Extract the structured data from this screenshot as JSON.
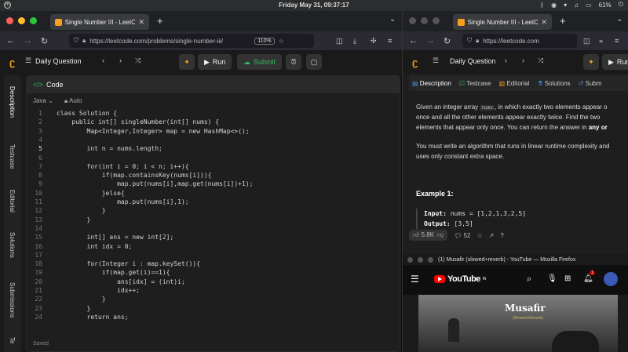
{
  "system": {
    "clock": "Friday May 31, 09:37:17",
    "battery": "61%"
  },
  "left_browser": {
    "tab_title": "Single Number III - LeetCode",
    "url": "https://leetcode.com/problems/single-number-iii/",
    "zoom": "110%"
  },
  "right_browser": {
    "tab_title": "Single Number III - LeetCode",
    "url": "https://leetcode.com"
  },
  "leetcode_toolbar": {
    "daily": "Daily Question",
    "run": "Run",
    "submit": "Submit"
  },
  "sidebar": {
    "items": [
      "Description",
      "Testcase",
      "Editorial",
      "Solutions",
      "Submissions",
      "Te"
    ]
  },
  "code_panel": {
    "title": "Code",
    "language": "Java",
    "auto": "Auto",
    "saved": "Saved",
    "lines": [
      "class Solution {",
      "    public int[] singleNumber(int[] nums) {",
      "        Map<Integer,Integer> map = new HashMap<>();",
      "",
      "        int n = nums.length;",
      "",
      "        for(int i = 0; i < n; i++){",
      "            if(map.containsKey(nums[i])){",
      "                map.put(nums[i],map.get(nums[i])+1);",
      "            }else{",
      "                map.put(nums[i],1);",
      "            }",
      "        }",
      "",
      "        int[] ans = new int[2];",
      "        int idx = 0;",
      "",
      "        for(Integer i : map.keySet()){",
      "            if(map.get(i)==1){",
      "                ans[idx] = (int)i;",
      "                idx++;",
      "            }",
      "        }",
      "        return ans;"
    ]
  },
  "description": {
    "tabs": [
      "Description",
      "Testcase",
      "Editorial",
      "Solutions",
      "Subm"
    ],
    "para1_lines": [
      "Given an integer array",
      "once and all the other elements appear exactly twice. Find the two",
      "elements that appear only once. You can return the answer in"
    ],
    "para1_code": "nums",
    "para1_tail1": ", in which exactly two elements appear o",
    "para1_bold": "any or",
    "para2_lines": [
      "You must write an algorithm that runs in linear runtime complexity and",
      "uses only constant extra space."
    ],
    "example_title": "Example 1:",
    "input_label": "Input:",
    "input_value": "nums = [1,2,1,3,2,5]",
    "output_label": "Output:",
    "output_value": "[3,5]",
    "likes": "5.8K",
    "comments": "52"
  },
  "youtube": {
    "window_title": "(1) Musafir (slowed+reverb) - YouTube — Mozilla Firefox",
    "logo": "YouTube",
    "region": "IN",
    "notif": "1",
    "thumb_title": "Musafir",
    "thumb_sub": "(Slowed+Reverb)"
  }
}
